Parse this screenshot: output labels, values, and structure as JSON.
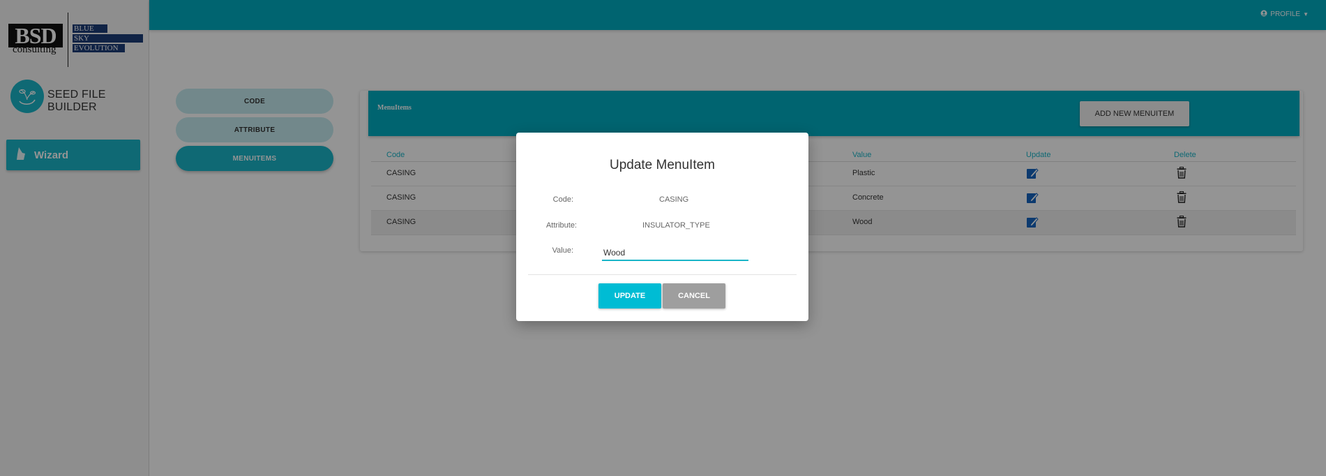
{
  "logo": {
    "bsd": "BSD",
    "consulting": "consulting",
    "tags": [
      "BLUE",
      "SKY",
      "EVOLUTION"
    ]
  },
  "brand": {
    "title": "SEED FILE BUILDER"
  },
  "sidebar": {
    "wizard_label": "Wizard"
  },
  "topbar": {
    "profile_label": "PROFILE"
  },
  "steps": {
    "code": "CODE",
    "attribute": "ATTRIBUTE",
    "menuitems": "MENUITEMS"
  },
  "card": {
    "title": "MenuItems",
    "add_button": "ADD NEW MENUITEM",
    "columns": {
      "code": "Code",
      "value": "Value",
      "update": "Update",
      "delete": "Delete"
    },
    "rows": [
      {
        "code": "CASING",
        "value": "Plastic"
      },
      {
        "code": "CASING",
        "value": "Concrete"
      },
      {
        "code": "CASING",
        "value": "Wood"
      }
    ]
  },
  "modal": {
    "title": "Update MenuItem",
    "code_label": "Code:",
    "code_value": "CASING",
    "attribute_label": "Attribute:",
    "attribute_value": "INSULATOR_TYPE",
    "value_label": "Value:",
    "value_input": "Wood",
    "update_button": "UPDATE",
    "cancel_button": "CANCEL"
  },
  "colors": {
    "primary": "#00acc1",
    "accent": "#1ab5c8",
    "edit_icon": "#1565c0",
    "cancel": "#9e9e9e"
  },
  "icons": {
    "profile": "account-circle-icon",
    "edit": "edit-icon",
    "delete": "trash-icon",
    "wizard": "wizard-icon"
  }
}
